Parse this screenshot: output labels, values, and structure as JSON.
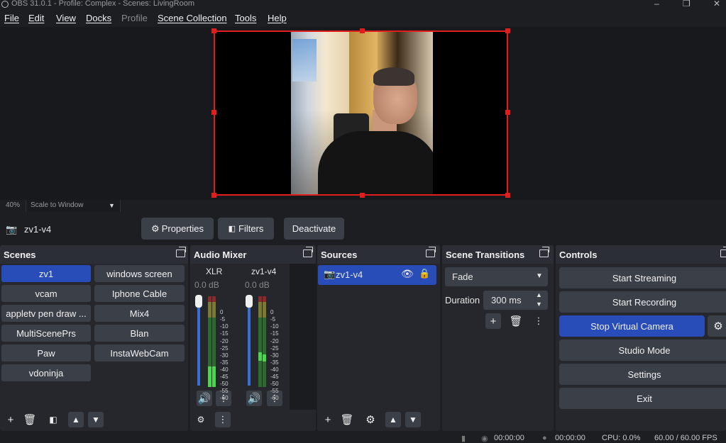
{
  "window": {
    "title": "OBS 31.0.1 - Profile: Complex - Scenes: LivingRoom",
    "controls": [
      "minimize-icon",
      "restore-icon",
      "close-icon"
    ]
  },
  "menu": [
    "File",
    "Edit",
    "View",
    "Docks",
    "Profile",
    "Scene Collection",
    "Tools",
    "Help"
  ],
  "menu_disabled": [
    "Profile"
  ],
  "preview": {
    "zoom": "40%",
    "scale_mode": "Scale to Window",
    "selection_color": "#e01e1e"
  },
  "context_bar": {
    "source_name": "zv1-v4",
    "properties_label": "Properties",
    "filters_label": "Filters",
    "deactivate_label": "Deactivate"
  },
  "scenes": {
    "title": "Scenes",
    "items": [
      "zv1",
      "windows screen",
      "vcam",
      "Iphone Cable",
      "appletv pen draw ...",
      "Mix4",
      "MultiScenePrs",
      "Blan",
      "Paw",
      "InstaWebCam",
      "vdoninja"
    ],
    "selected": "zv1"
  },
  "audio_mixer": {
    "title": "Audio Mixer",
    "channels": [
      {
        "name": "XLR",
        "db": "0.0 dB",
        "volume": 1.0
      },
      {
        "name": "zv1-v4",
        "db": "0.0 dB",
        "volume": 1.0
      }
    ],
    "ticks": [
      "0",
      "-5",
      "-10",
      "-15",
      "-20",
      "-25",
      "-30",
      "-35",
      "-40",
      "-45",
      "-50",
      "-55",
      "-60"
    ]
  },
  "sources": {
    "title": "Sources",
    "items": [
      {
        "name": "zv1-v4",
        "visible": true,
        "locked": true
      }
    ]
  },
  "scene_transitions": {
    "title": "Scene Transitions",
    "transition": "Fade",
    "duration_label": "Duration",
    "duration_value": "300 ms"
  },
  "controls": {
    "title": "Controls",
    "buttons": [
      "Start Streaming",
      "Start Recording",
      "Stop Virtual Camera",
      "Studio Mode",
      "Settings",
      "Exit"
    ],
    "active": "Stop Virtual Camera",
    "accent": "#284cb8"
  },
  "status": {
    "stream_time": "00:00:00",
    "rec_time": "00:00:00",
    "cpu": "CPU: 0.0%",
    "fps": "60.00 / 60.00 FPS"
  }
}
